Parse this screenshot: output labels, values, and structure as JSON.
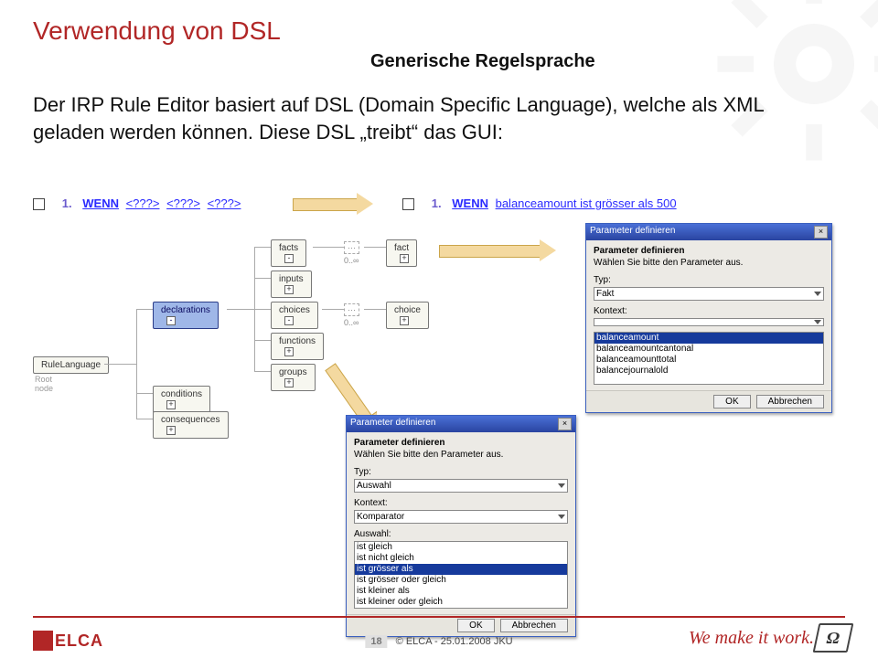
{
  "title": "Verwendung von DSL",
  "subtitle": "Generische Regelsprache",
  "body_text": "Der IRP Rule Editor basiert auf DSL (Domain Specific Language), welche als XML geladen werden können. Diese DSL „treibt“ das GUI:",
  "rule_left": {
    "num": "1.",
    "tokens": [
      "WENN",
      "<???>",
      "<???>",
      "<???>"
    ]
  },
  "rule_right": {
    "num": "1.",
    "wenn": "WENN",
    "rest": "balanceamount ist grösser als 500"
  },
  "tree": {
    "root": "RuleLanguage",
    "root_sub": "Root node",
    "declarations": "declarations",
    "conditions": "conditions",
    "consequences": "consequences",
    "facts": "facts",
    "fact": "fact",
    "inputs": "inputs",
    "choices": "choices",
    "choice": "choice",
    "functions": "functions",
    "groups": "groups",
    "range": "0..∞"
  },
  "modal_top": {
    "title": "Parameter definieren",
    "heading": "Parameter definieren",
    "sub": "Wählen Sie bitte den Parameter aus.",
    "typ_label": "Typ:",
    "typ_value": "Fakt",
    "kontext_label": "Kontext:",
    "kontext_value": "",
    "list_label": "",
    "options": [
      "balanceamount",
      "balanceamountcantonal",
      "balanceamounttotal",
      "balancejournalold"
    ],
    "selected": "balanceamount",
    "ok": "OK",
    "cancel": "Abbrechen"
  },
  "modal_bottom": {
    "title": "Parameter definieren",
    "heading": "Parameter definieren",
    "sub": "Wählen Sie bitte den Parameter aus.",
    "typ_label": "Typ:",
    "typ_value": "Auswahl",
    "kontext_label": "Kontext:",
    "kontext_value": "Komparator",
    "list_label": "Auswahl:",
    "options": [
      "ist gleich",
      "ist nicht gleich",
      "ist grösser als",
      "ist grösser oder gleich",
      "ist kleiner als",
      "ist kleiner oder gleich"
    ],
    "selected": "ist grösser als",
    "ok": "OK",
    "cancel": "Abbrechen"
  },
  "footer": {
    "logo_text": "ELCA",
    "page_num": "18",
    "copyright": "© ELCA - 25.01.2008 JKU",
    "slogan": "We make it work."
  }
}
